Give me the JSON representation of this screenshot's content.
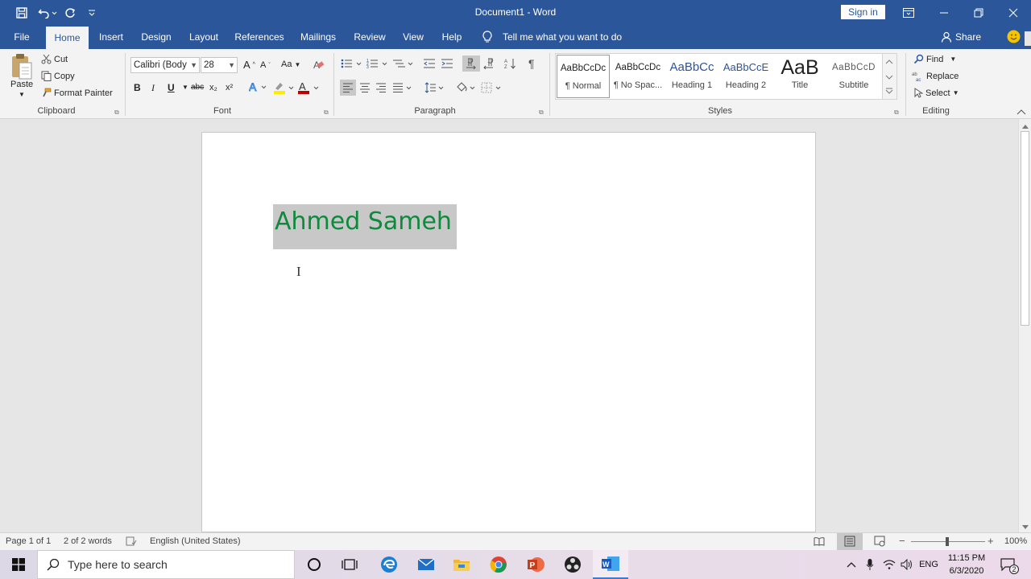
{
  "titlebar": {
    "title": "Document1  -  Word",
    "signin_label": "Sign in",
    "qat": {
      "save_icon": "save-icon",
      "undo_icon": "undo-icon",
      "redo_icon": "redo-icon",
      "customize_icon": "customize-qat-icon"
    }
  },
  "tabs": [
    "File",
    "Home",
    "Insert",
    "Design",
    "Layout",
    "References",
    "Mailings",
    "Review",
    "View",
    "Help"
  ],
  "active_tab": "Home",
  "tell_me": "Tell me what you want to do",
  "share_label": "Share",
  "clipboard": {
    "paste_label": "Paste",
    "cut_label": "Cut",
    "copy_label": "Copy",
    "format_painter_label": "Format Painter",
    "group_label": "Clipboard"
  },
  "font": {
    "family": "Calibri (Body",
    "size": "28",
    "group_label": "Font",
    "buttons": [
      "B",
      "I",
      "U",
      "abc",
      "x₂",
      "x²"
    ],
    "case_label": "Aa"
  },
  "paragraph": {
    "group_label": "Paragraph"
  },
  "styles": {
    "group_label": "Styles",
    "items": [
      {
        "preview": "AaBbCcDc",
        "name": "¶ Normal"
      },
      {
        "preview": "AaBbCcDc",
        "name": "¶ No Spac..."
      },
      {
        "preview": "AaBbCc",
        "name": "Heading 1"
      },
      {
        "preview": "AaBbCcE",
        "name": "Heading 2"
      },
      {
        "preview": "AaB",
        "name": "Title"
      },
      {
        "preview": "AaBbCcD",
        "name": "Subtitle"
      }
    ]
  },
  "editing": {
    "find_label": "Find",
    "replace_label": "Replace",
    "select_label": "Select",
    "group_label": "Editing"
  },
  "document": {
    "text": "Ahmed Sameh",
    "text_color": "#0f8a3c",
    "selection_color": "#c8c8c8"
  },
  "status": {
    "page": "Page 1 of 1",
    "words": "2 of 2 words",
    "language": "English (United States)",
    "zoom": "100%"
  },
  "taskbar": {
    "search_placeholder": "Type here to search",
    "lang": "ENG",
    "time": "11:15 PM",
    "date": "6/3/2020",
    "notifications": "2"
  },
  "colors": {
    "accent": "#2b579a"
  }
}
